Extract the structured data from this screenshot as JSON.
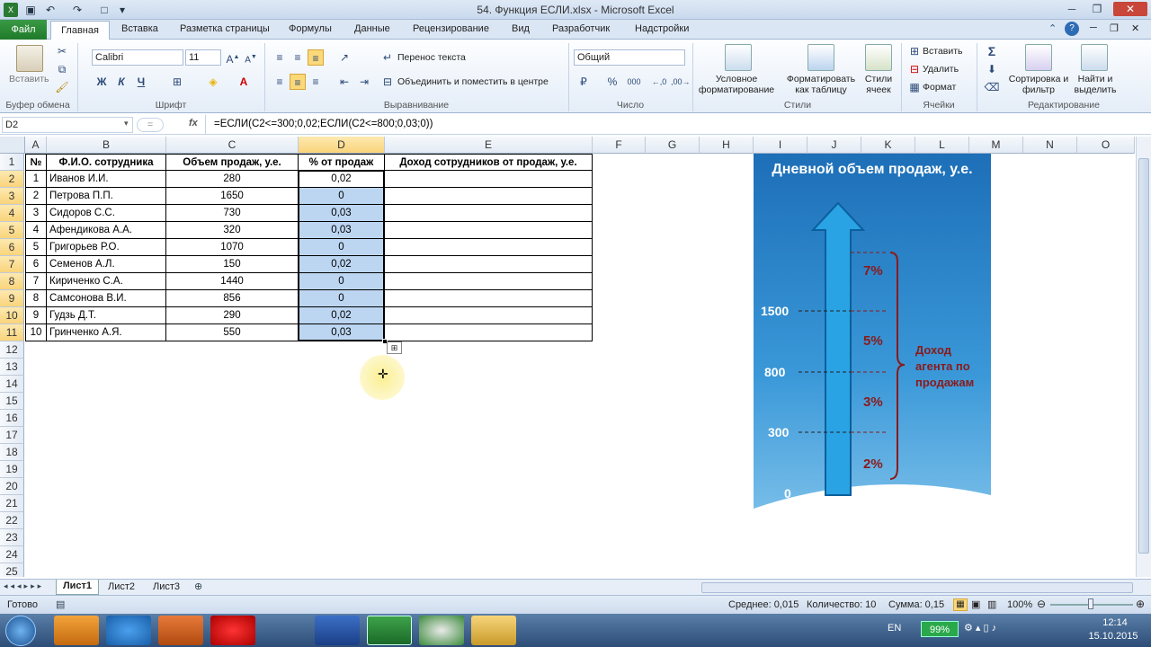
{
  "window": {
    "title": "54. Функция ЕСЛИ.xlsx - Microsoft Excel"
  },
  "tabs": [
    "Файл",
    "Главная",
    "Вставка",
    "Разметка страницы",
    "Формулы",
    "Данные",
    "Рецензирование",
    "Вид",
    "Разработчик",
    "Надстройки"
  ],
  "ribbon": {
    "clipboard": {
      "paste": "Вставить",
      "group": "Буфер обмена"
    },
    "font": {
      "name": "Calibri",
      "size": "11",
      "bold": "Ж",
      "italic": "К",
      "underline": "Ч",
      "group": "Шрифт"
    },
    "alignment": {
      "wrap": "Перенос текста",
      "merge": "Объединить и поместить в центре",
      "group": "Выравнивание"
    },
    "number": {
      "format": "Общий",
      "percent": "%",
      "thousands": "000",
      "group": "Число"
    },
    "styles": {
      "conditional": "Условное форматирование",
      "as_table": "Форматировать как таблицу",
      "cell_styles": "Стили ячеек",
      "group": "Стили"
    },
    "cells": {
      "insert": "Вставить",
      "delete": "Удалить",
      "format": "Формат",
      "group": "Ячейки"
    },
    "editing": {
      "sum": "Σ",
      "sort": "Сортировка и фильтр",
      "find": "Найти и выделить",
      "group": "Редактирование"
    }
  },
  "formula_bar": {
    "name_box": "D2",
    "fx": "fx",
    "formula": "=ЕСЛИ(C2<=300;0,02;ЕСЛИ(C2<=800;0,03;0))"
  },
  "columns": [
    "A",
    "B",
    "C",
    "D",
    "E",
    "F",
    "G",
    "H",
    "I",
    "J",
    "K",
    "L",
    "M",
    "N",
    "O"
  ],
  "rows": [
    "1",
    "2",
    "3",
    "4",
    "5",
    "6",
    "7",
    "8",
    "9",
    "10",
    "11",
    "12",
    "13",
    "14",
    "15",
    "16",
    "17",
    "18",
    "19",
    "20",
    "21",
    "22",
    "23",
    "24",
    "25"
  ],
  "table": {
    "headers": [
      "№",
      "Ф.И.О. сотрудника",
      "Объем продаж, у.е.",
      "% от продаж",
      "Доход сотрудников от продаж, у.е."
    ],
    "rows": [
      [
        "1",
        "Иванов И.И.",
        "280",
        "0,02",
        ""
      ],
      [
        "2",
        "Петрова П.П.",
        "1650",
        "0",
        ""
      ],
      [
        "3",
        "Сидоров С.С.",
        "730",
        "0,03",
        ""
      ],
      [
        "4",
        "Афендикова А.А.",
        "320",
        "0,03",
        ""
      ],
      [
        "5",
        "Григорьев Р.О.",
        "1070",
        "0",
        ""
      ],
      [
        "6",
        "Семенов А.Л.",
        "150",
        "0,02",
        ""
      ],
      [
        "7",
        "Кириченко С.А.",
        "1440",
        "0",
        ""
      ],
      [
        "8",
        "Самсонова В.И.",
        "856",
        "0",
        ""
      ],
      [
        "9",
        "Гудзь Д.Т.",
        "290",
        "0,02",
        ""
      ],
      [
        "10",
        "Гринченко А.Я.",
        "550",
        "0,03",
        ""
      ]
    ]
  },
  "infographic": {
    "title": "Дневной объем продаж, у.е.",
    "scale_values": [
      "1500",
      "800",
      "300",
      "0"
    ],
    "percents": [
      "7%",
      "5%",
      "3%",
      "2%"
    ],
    "note": "Доход агента по продажам"
  },
  "sheets": [
    "Лист1",
    "Лист2",
    "Лист3"
  ],
  "status": {
    "ready": "Готово",
    "average": "Среднее: 0,015",
    "count": "Количество: 10",
    "sum": "Сумма: 0,15",
    "zoom": "100%"
  },
  "taskbar": {
    "lang": "EN",
    "battery": "99%",
    "time": "12:14",
    "date": "15.10.2015"
  }
}
